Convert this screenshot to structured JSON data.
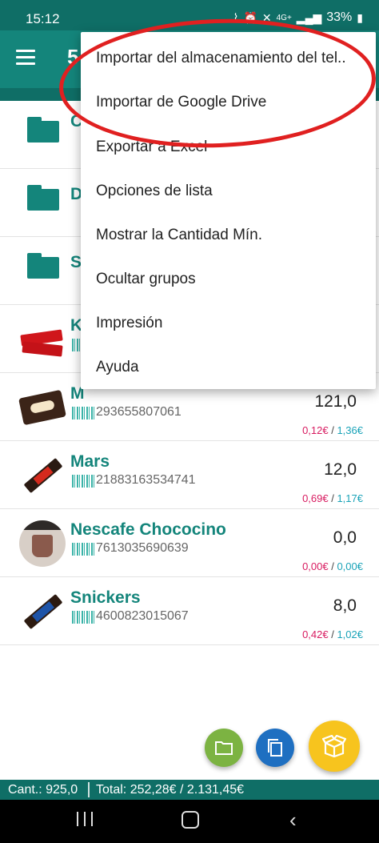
{
  "status_bar": {
    "time": "15:12",
    "network": "4G+",
    "battery": "33%"
  },
  "app_bar": {
    "title": "5"
  },
  "list": {
    "groups": [
      {
        "title": "C"
      },
      {
        "title": "D"
      },
      {
        "title": "S"
      }
    ],
    "products": [
      {
        "name": "K",
        "code": "",
        "qty": "",
        "price_a": "",
        "price_b": ""
      },
      {
        "name": "M",
        "code": "293655807061",
        "qty": "121,0",
        "price_a": "0,12€",
        "price_b": "1,36€"
      },
      {
        "name": "Mars",
        "code": "21883163534741",
        "qty": "12,0",
        "price_a": "0,69€",
        "price_b": "1,17€"
      },
      {
        "name": "Nescafe Chococino",
        "code": "7613035690639",
        "qty": "0,0",
        "price_a": "0,00€",
        "price_b": "0,00€"
      },
      {
        "name": "Snickers",
        "code": "4600823015067",
        "qty": "8,0",
        "price_a": "0,42€",
        "price_b": "1,02€"
      }
    ],
    "price_separator": " / "
  },
  "popup_menu": {
    "items": [
      "Importar del almacenamiento del tel..",
      "Importar de Google Drive",
      "Exportar a Excel",
      "Opciones de lista",
      "Mostrar la Cantidad Mín.",
      "Ocultar grupos",
      "Impresión",
      "Ayuda"
    ]
  },
  "summary": {
    "count": "Cant.: 925,0",
    "total": "Total: 252,28€ / 2.131,45€"
  },
  "colors": {
    "primary": "#14857b",
    "primary_dark": "#0f6e66",
    "price_a": "#d81b60",
    "price_b": "#1aa3b8",
    "fab_folder": "#7cb342",
    "fab_copy": "#1e6fc1",
    "fab_box": "#f7c41e",
    "annotation": "#e02020"
  },
  "icons": {
    "status": [
      "nfc-icon",
      "alarm-icon",
      "mute-icon",
      "signal-icon",
      "battery-icon"
    ],
    "fabs": [
      "folder-icon",
      "copy-icon",
      "box-icon"
    ],
    "nav": [
      "recent-apps-icon",
      "home-icon",
      "back-icon"
    ]
  }
}
